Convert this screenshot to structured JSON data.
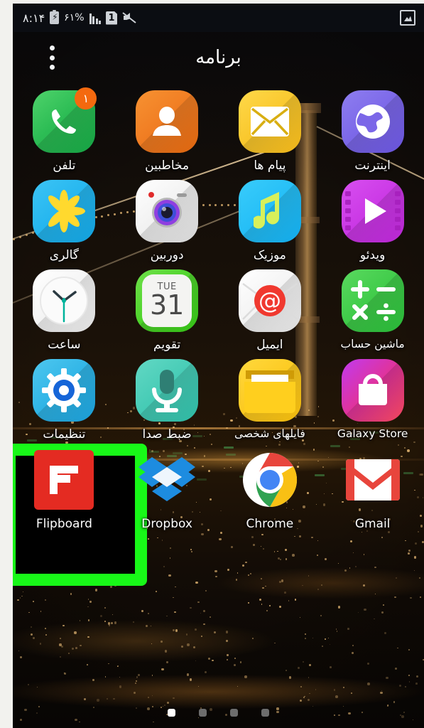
{
  "status_bar": {
    "time": "۸:۱۴",
    "battery_percent": "۶۱%",
    "battery_icon": "battery-charging-icon",
    "signal_icon": "signal-bars-icon",
    "sim_label": "1",
    "mute_icon": "sound-mute-icon",
    "screenshot_icon": "screenshot-image-icon"
  },
  "header": {
    "title": "برنامه",
    "menu_icon": "more-options-icon"
  },
  "colors": {
    "highlight": "#18f818",
    "badge": "#f4690f",
    "background": "#05070c",
    "label_text": "#ffffff"
  },
  "grid": {
    "rows": [
      [
        {
          "label": "تلفن",
          "icon": "phone-icon",
          "badge": "۱"
        },
        {
          "label": "مخاطبین",
          "icon": "contacts-icon",
          "badge": ""
        },
        {
          "label": "پیام ها",
          "icon": "messages-icon",
          "badge": ""
        },
        {
          "label": "اینترنت",
          "icon": "internet-browser-icon",
          "badge": ""
        }
      ],
      [
        {
          "label": "گالری",
          "icon": "gallery-icon",
          "badge": ""
        },
        {
          "label": "دوربین",
          "icon": "camera-icon",
          "badge": ""
        },
        {
          "label": "موزیک",
          "icon": "music-icon",
          "badge": ""
        },
        {
          "label": "ویدئو",
          "icon": "video-player-icon",
          "badge": ""
        }
      ],
      [
        {
          "label": "ساعت",
          "icon": "clock-icon",
          "badge": ""
        },
        {
          "label": "تقویم",
          "icon": "calendar-icon",
          "badge": "",
          "cal_day": "31",
          "cal_weekday": "TUE"
        },
        {
          "label": "ایمیل",
          "icon": "email-icon",
          "badge": ""
        },
        {
          "label": "ماشین حساب",
          "icon": "calculator-icon",
          "badge": ""
        }
      ],
      [
        {
          "label": "تنظیمات",
          "icon": "settings-gear-icon",
          "badge": "",
          "highlighted": true
        },
        {
          "label": "ضبط صدا",
          "icon": "voice-recorder-icon",
          "badge": ""
        },
        {
          "label": "فایلهای شخصی",
          "icon": "my-files-folder-icon",
          "badge": ""
        },
        {
          "label": "Galaxy Store",
          "icon": "galaxy-store-icon",
          "badge": ""
        }
      ],
      [
        {
          "label": "Flipboard",
          "icon": "flipboard-icon",
          "badge": ""
        },
        {
          "label": "Dropbox",
          "icon": "dropbox-icon",
          "badge": ""
        },
        {
          "label": "Chrome",
          "icon": "chrome-icon",
          "badge": ""
        },
        {
          "label": "Gmail",
          "icon": "gmail-icon",
          "badge": ""
        }
      ]
    ]
  },
  "page_indicator": {
    "total": 4,
    "active_index": 0
  }
}
